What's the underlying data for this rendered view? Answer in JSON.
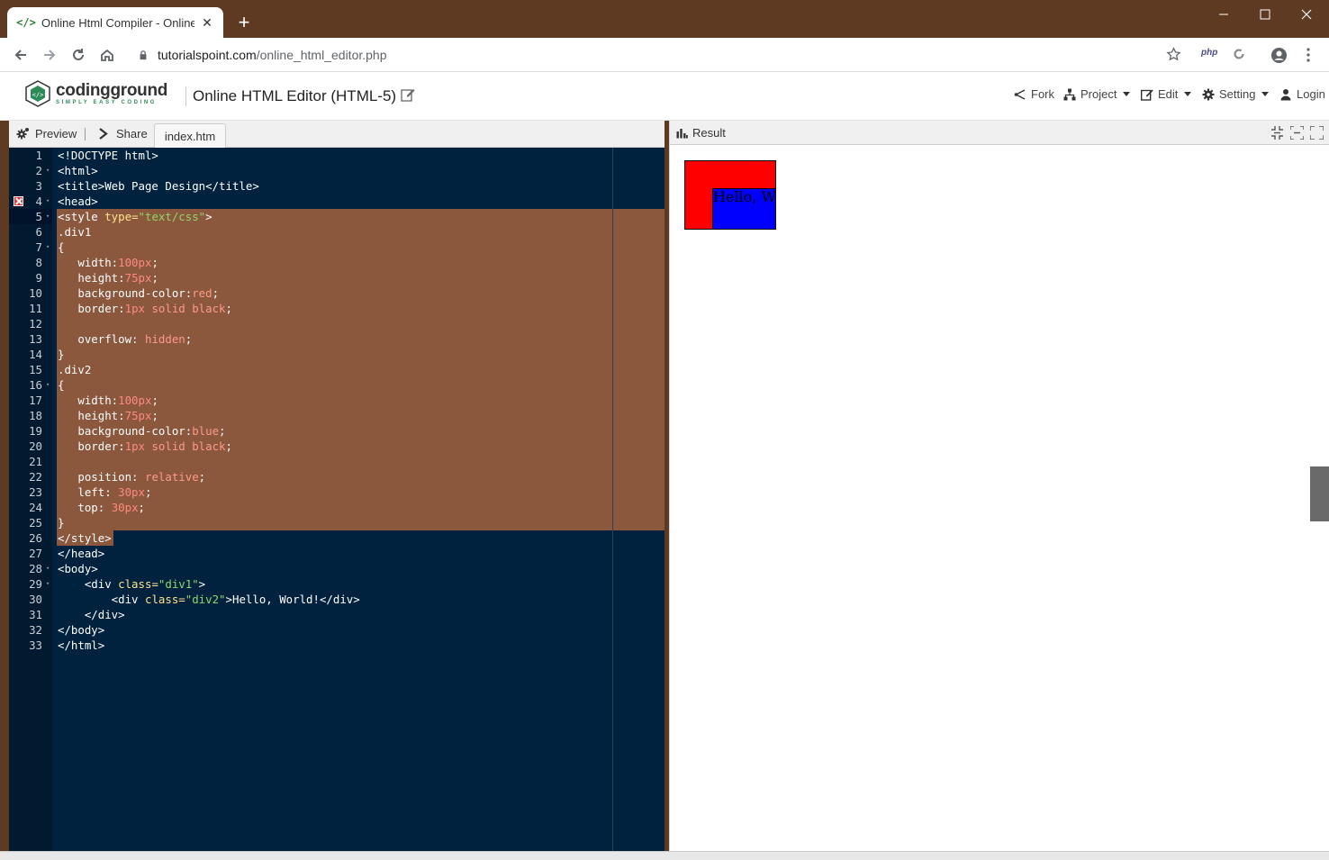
{
  "browser": {
    "tab_title": "Online Html Compiler - Online H",
    "url_host": "tutorialspoint.com",
    "url_path": "/online_html_editor.php",
    "ext_php_label": "php",
    "icons": [
      "code-favicon-icon",
      "close-icon",
      "plus-icon",
      "back-icon",
      "forward-icon",
      "reload-icon",
      "home-icon",
      "lock-icon",
      "star-icon",
      "profile-icon",
      "kebab-menu-icon"
    ]
  },
  "site": {
    "logo_name": "codingground",
    "logo_tagline": "SIMPLY EASY CODING",
    "page_title": "Online HTML Editor (HTML-5)",
    "nav": {
      "fork": "Fork",
      "project": "Project",
      "edit": "Edit",
      "setting": "Setting",
      "login": "Login"
    }
  },
  "editor": {
    "toolbar": {
      "preview": "Preview",
      "share": "Share",
      "file_tab": "index.htm"
    },
    "error_line": 4,
    "lines": [
      {
        "n": "1",
        "fold": false
      },
      {
        "n": "2",
        "fold": true
      },
      {
        "n": "3",
        "fold": false
      },
      {
        "n": "4",
        "fold": true
      },
      {
        "n": "5",
        "fold": true
      },
      {
        "n": "6",
        "fold": false
      },
      {
        "n": "7",
        "fold": true
      },
      {
        "n": "8",
        "fold": false
      },
      {
        "n": "9",
        "fold": false
      },
      {
        "n": "10",
        "fold": false
      },
      {
        "n": "11",
        "fold": false
      },
      {
        "n": "12",
        "fold": false
      },
      {
        "n": "13",
        "fold": false
      },
      {
        "n": "14",
        "fold": false
      },
      {
        "n": "15",
        "fold": false
      },
      {
        "n": "16",
        "fold": true
      },
      {
        "n": "17",
        "fold": false
      },
      {
        "n": "18",
        "fold": false
      },
      {
        "n": "19",
        "fold": false
      },
      {
        "n": "20",
        "fold": false
      },
      {
        "n": "21",
        "fold": false
      },
      {
        "n": "22",
        "fold": false
      },
      {
        "n": "23",
        "fold": false
      },
      {
        "n": "24",
        "fold": false
      },
      {
        "n": "25",
        "fold": false
      },
      {
        "n": "26",
        "fold": false
      },
      {
        "n": "27",
        "fold": false
      },
      {
        "n": "28",
        "fold": true
      },
      {
        "n": "29",
        "fold": true
      },
      {
        "n": "30",
        "fold": false
      },
      {
        "n": "31",
        "fold": false
      },
      {
        "n": "32",
        "fold": false
      },
      {
        "n": "33",
        "fold": false
      }
    ],
    "code": [
      [
        [
          "t-tag",
          "<!DOCTYPE html>"
        ]
      ],
      [
        [
          "t-tag",
          "<html>"
        ]
      ],
      [
        [
          "t-tag",
          "<title>"
        ],
        [
          "t-prop",
          "Web Page Design"
        ],
        [
          "t-tag",
          "</title>"
        ]
      ],
      [
        [
          "t-tag",
          "<head>"
        ]
      ],
      [
        [
          "t-tag",
          "<style "
        ],
        [
          "t-kw",
          "type="
        ],
        [
          "t-str",
          "\"text/css\""
        ],
        [
          "t-tag",
          ">"
        ]
      ],
      [
        [
          "t-prop",
          ".div1"
        ]
      ],
      [
        [
          "t-prop",
          "{"
        ]
      ],
      [
        [
          "t-prop",
          "   width:"
        ],
        [
          "t-num",
          "100px"
        ],
        [
          "t-prop",
          ";"
        ]
      ],
      [
        [
          "t-prop",
          "   height:"
        ],
        [
          "t-num",
          "75px"
        ],
        [
          "t-prop",
          ";"
        ]
      ],
      [
        [
          "t-prop",
          "   background-color:"
        ],
        [
          "t-val",
          "red"
        ],
        [
          "t-prop",
          ";"
        ]
      ],
      [
        [
          "t-prop",
          "   border:"
        ],
        [
          "t-num",
          "1px"
        ],
        [
          "t-val",
          " solid black"
        ],
        [
          "t-prop",
          ";"
        ]
      ],
      [
        [
          "t-prop",
          ""
        ]
      ],
      [
        [
          "t-prop",
          "   overflow: "
        ],
        [
          "t-val",
          "hidden"
        ],
        [
          "t-prop",
          ";"
        ]
      ],
      [
        [
          "t-prop",
          "}"
        ]
      ],
      [
        [
          "t-prop",
          ".div2"
        ]
      ],
      [
        [
          "t-prop",
          "{"
        ]
      ],
      [
        [
          "t-prop",
          "   width:"
        ],
        [
          "t-num",
          "100px"
        ],
        [
          "t-prop",
          ";"
        ]
      ],
      [
        [
          "t-prop",
          "   height:"
        ],
        [
          "t-num",
          "75px"
        ],
        [
          "t-prop",
          ";"
        ]
      ],
      [
        [
          "t-prop",
          "   background-color:"
        ],
        [
          "t-val",
          "blue"
        ],
        [
          "t-prop",
          ";"
        ]
      ],
      [
        [
          "t-prop",
          "   border:"
        ],
        [
          "t-num",
          "1px"
        ],
        [
          "t-val",
          " solid black"
        ],
        [
          "t-prop",
          ";"
        ]
      ],
      [
        [
          "t-prop",
          ""
        ]
      ],
      [
        [
          "t-prop",
          "   position: "
        ],
        [
          "t-val",
          "relative"
        ],
        [
          "t-prop",
          ";"
        ]
      ],
      [
        [
          "t-prop",
          "   left: "
        ],
        [
          "t-num",
          "30px"
        ],
        [
          "t-prop",
          ";"
        ]
      ],
      [
        [
          "t-prop",
          "   top: "
        ],
        [
          "t-num",
          "30px"
        ],
        [
          "t-prop",
          ";"
        ]
      ],
      [
        [
          "t-prop",
          "}"
        ]
      ],
      [
        [
          "t-tag",
          "</style>"
        ]
      ],
      [
        [
          "t-tag",
          "</head>"
        ]
      ],
      [
        [
          "t-tag",
          "<body>"
        ]
      ],
      [
        [
          "t-tag",
          "    <div "
        ],
        [
          "t-kw",
          "class="
        ],
        [
          "t-str",
          "\"div1\""
        ],
        [
          "t-tag",
          ">"
        ]
      ],
      [
        [
          "t-tag",
          "        <div "
        ],
        [
          "t-kw",
          "class="
        ],
        [
          "t-str",
          "\"div2\""
        ],
        [
          "t-tag",
          ">"
        ],
        [
          "t-prop",
          "Hello, World!"
        ],
        [
          "t-tag",
          "</div>"
        ]
      ],
      [
        [
          "t-tag",
          "    </div>"
        ]
      ],
      [
        [
          "t-tag",
          "</body>"
        ]
      ],
      [
        [
          "t-tag",
          "</html>"
        ]
      ]
    ]
  },
  "result": {
    "label": "Result",
    "demo_text": "Hello, World!",
    "colors": {
      "div1": "#ff0000",
      "div2": "#0000ff"
    }
  }
}
